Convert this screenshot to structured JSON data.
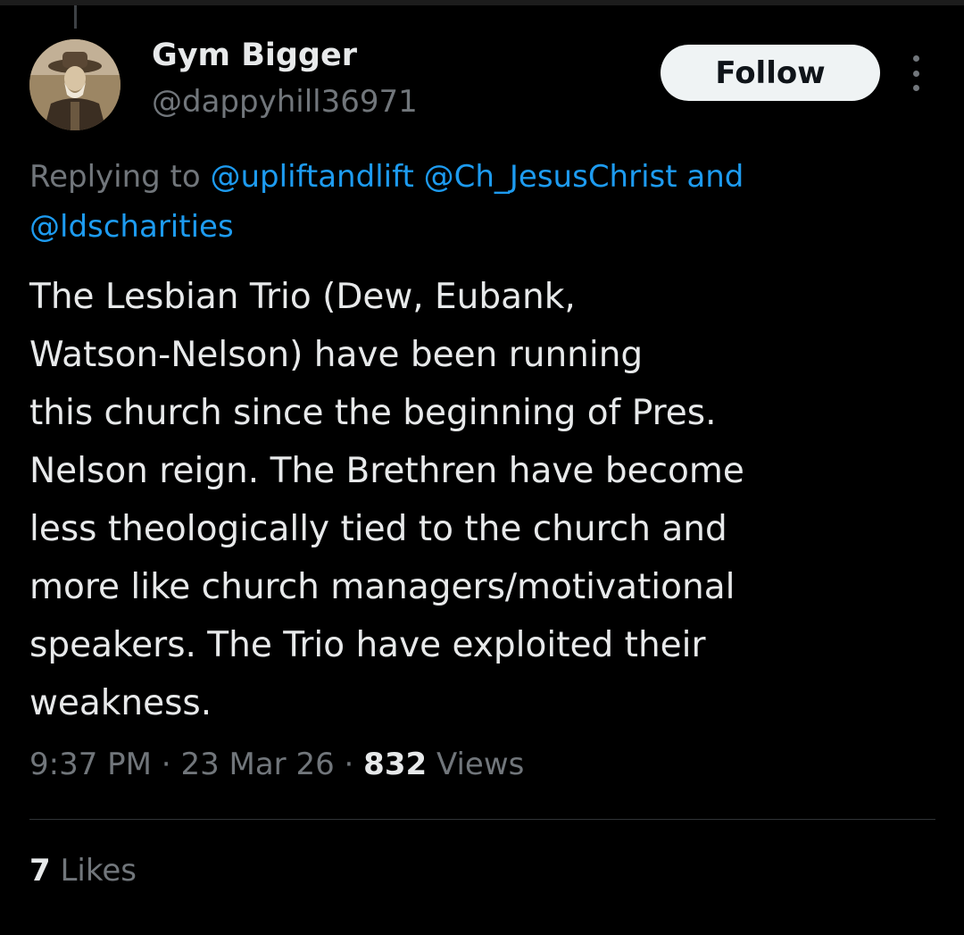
{
  "user": {
    "display_name": "Gym Bigger",
    "handle": "@dappyhill36971"
  },
  "actions": {
    "follow_label": "Follow",
    "more_icon": "more-vertical-icon"
  },
  "reply": {
    "prefix": "Replying to ",
    "mentions": [
      "@upliftandlift",
      "@Ch_JesusChrist",
      "@ldscharities"
    ],
    "joiner": " and"
  },
  "tweet": {
    "lines": [
      "The Lesbian Trio (Dew, Eubank,",
      "Watson-Nelson) have been running",
      "this church since the beginning of Pres.",
      "Nelson reign. The Brethren have become",
      "less theologically tied to the church and",
      "more like church managers/motivational",
      "speakers. The Trio have exploited their",
      "weakness."
    ]
  },
  "meta": {
    "time": "9:37 PM",
    "date": "23 Mar 26",
    "separator": " · ",
    "views_count": "832",
    "views_label": " Views"
  },
  "stats": {
    "likes_count": "7",
    "likes_label": " Likes"
  },
  "colors": {
    "background": "#000000",
    "text_primary": "#e7e9ea",
    "text_secondary": "#71767b",
    "link": "#1d9bf0",
    "follow_bg": "#eff3f4"
  }
}
